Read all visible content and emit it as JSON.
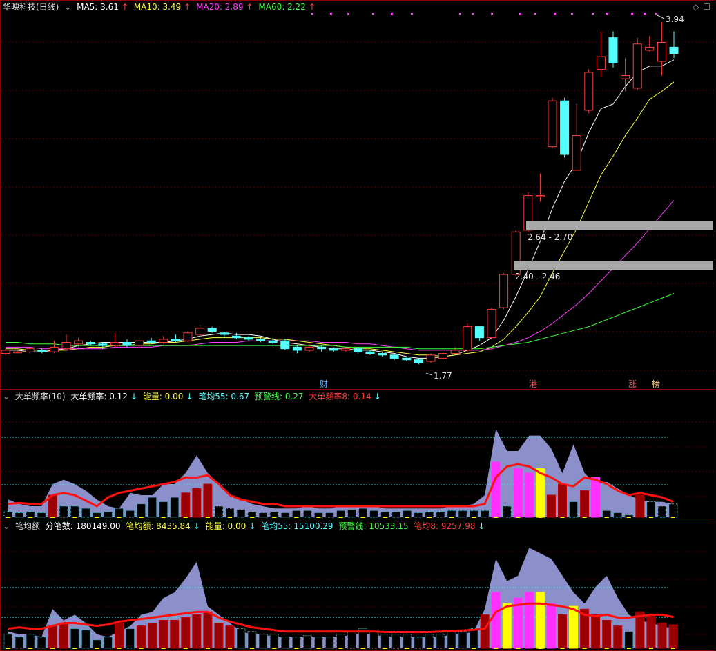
{
  "main": {
    "title": "华映科技(日线)",
    "ma5_label": "MA5: 3.61",
    "ma10_label": "MA10: 3.49",
    "ma20_label": "MA20: 2.89",
    "ma60_label": "MA60: 2.22",
    "high_label": "3.94",
    "low_label": "1.77",
    "zone1_label": "2.64 - 2.70",
    "zone2_label": "2.40 - 2.46",
    "markers": [
      "财",
      "港",
      "涨",
      "榜"
    ]
  },
  "panel1": {
    "title": "大单频率(10)",
    "v1": "大单频率: 0.12",
    "v2": "能量: 0.00",
    "v3": "笔均55: 0.67",
    "v4": "预警线: 0.27",
    "v5": "大单频率8: 0.14"
  },
  "panel2": {
    "title": "笔均额",
    "v1": "分笔数: 180149.00",
    "v2": "笔均额: 8435.84",
    "v3": "能量: 0.00",
    "v4": "笔均55: 15100.29",
    "v5": "预警线: 10533.15",
    "v6": "笔均8: 9257.98"
  },
  "colors": {
    "up": "#ff3c3c",
    "down": "#54ffff",
    "ma5": "#ffffff",
    "ma10": "#ffff40",
    "ma20": "#ff40ff",
    "ma60": "#40ff40",
    "area": "#9a9ee0"
  },
  "chart_data": [
    {
      "type": "candlestick",
      "title": "华映科技(日线)",
      "ylim": [
        1.72,
        4.0
      ],
      "series": [
        {
          "name": "K",
          "values": [
            [
              1.84,
              1.86,
              1.87,
              1.83
            ],
            [
              1.85,
              1.85,
              1.86,
              1.84
            ],
            [
              1.85,
              1.87,
              1.88,
              1.84
            ],
            [
              1.86,
              1.85,
              1.87,
              1.84
            ],
            [
              1.85,
              1.88,
              1.92,
              1.84
            ],
            [
              1.87,
              1.91,
              1.96,
              1.86
            ],
            [
              1.9,
              1.92,
              1.94,
              1.88
            ],
            [
              1.91,
              1.9,
              1.92,
              1.89
            ],
            [
              1.9,
              1.89,
              1.91,
              1.87
            ],
            [
              1.89,
              1.91,
              1.97,
              1.88
            ],
            [
              1.91,
              1.89,
              1.93,
              1.88
            ],
            [
              1.89,
              1.92,
              1.94,
              1.88
            ],
            [
              1.92,
              1.91,
              1.94,
              1.9
            ],
            [
              1.91,
              1.93,
              1.95,
              1.9
            ],
            [
              1.93,
              1.92,
              1.96,
              1.91
            ],
            [
              1.92,
              1.97,
              1.98,
              1.91
            ],
            [
              1.96,
              2.0,
              2.02,
              1.95
            ],
            [
              2.0,
              1.98,
              2.01,
              1.97
            ],
            [
              1.97,
              1.96,
              1.98,
              1.94
            ],
            [
              1.95,
              1.94,
              1.97,
              1.93
            ],
            [
              1.94,
              1.93,
              1.95,
              1.92
            ],
            [
              1.93,
              1.92,
              1.94,
              1.91
            ],
            [
              1.92,
              1.91,
              1.94,
              1.9
            ],
            [
              1.92,
              1.87,
              1.93,
              1.86
            ],
            [
              1.88,
              1.86,
              1.89,
              1.84
            ],
            [
              1.86,
              1.88,
              1.9,
              1.85
            ],
            [
              1.88,
              1.87,
              1.89,
              1.85
            ],
            [
              1.87,
              1.86,
              1.88,
              1.85
            ],
            [
              1.86,
              1.87,
              1.88,
              1.85
            ],
            [
              1.87,
              1.85,
              1.88,
              1.84
            ],
            [
              1.85,
              1.84,
              1.86,
              1.83
            ],
            [
              1.84,
              1.83,
              1.85,
              1.82
            ],
            [
              1.83,
              1.81,
              1.84,
              1.8
            ],
            [
              1.81,
              1.8,
              1.82,
              1.79
            ],
            [
              1.8,
              1.78,
              1.81,
              1.77
            ],
            [
              1.79,
              1.83,
              1.84,
              1.78
            ],
            [
              1.81,
              1.84,
              1.85,
              1.8
            ],
            [
              1.84,
              1.86,
              1.88,
              1.83
            ],
            [
              1.86,
              2.01,
              2.03,
              1.85
            ],
            [
              2.01,
              1.94,
              2.0,
              1.92
            ],
            [
              1.94,
              2.12,
              2.13,
              1.93
            ],
            [
              2.13,
              2.34,
              2.35,
              2.12
            ],
            [
              2.34,
              2.61,
              2.62,
              2.33
            ],
            [
              2.62,
              2.84,
              2.86,
              2.61
            ],
            [
              2.84,
              2.84,
              2.98,
              2.8
            ],
            [
              3.15,
              3.44,
              3.46,
              3.14
            ],
            [
              3.44,
              3.1,
              3.46,
              3.08
            ],
            [
              3.0,
              3.22,
              3.42,
              3.0
            ],
            [
              3.38,
              3.62,
              3.64,
              3.36
            ],
            [
              3.64,
              3.72,
              3.88,
              3.59
            ],
            [
              3.84,
              3.68,
              3.88,
              3.65
            ],
            [
              3.58,
              3.6,
              3.71,
              3.5
            ],
            [
              3.52,
              3.8,
              3.84,
              3.51
            ],
            [
              3.76,
              3.78,
              3.85,
              3.75
            ],
            [
              3.69,
              3.81,
              3.94,
              3.6
            ],
            [
              3.78,
              3.74,
              3.88,
              3.71
            ]
          ]
        },
        {
          "name": "MA5",
          "values": [
            1.86,
            1.86,
            1.85,
            1.85,
            1.86,
            1.87,
            1.89,
            1.9,
            1.91,
            1.91,
            1.91,
            1.91,
            1.91,
            1.91,
            1.92,
            1.93,
            1.95,
            1.96,
            1.97,
            1.96,
            1.96,
            1.95,
            1.93,
            1.91,
            1.9,
            1.89,
            1.88,
            1.87,
            1.87,
            1.86,
            1.86,
            1.85,
            1.84,
            1.82,
            1.81,
            1.81,
            1.82,
            1.83,
            1.86,
            1.89,
            1.94,
            2.05,
            2.2,
            2.37,
            2.55,
            2.76,
            2.93,
            3.05,
            3.24,
            3.39,
            3.42,
            3.53,
            3.62,
            3.66,
            3.66,
            3.7
          ]
        },
        {
          "name": "MA10",
          "values": [
            1.87,
            1.87,
            1.86,
            1.86,
            1.86,
            1.86,
            1.87,
            1.88,
            1.88,
            1.89,
            1.89,
            1.9,
            1.9,
            1.91,
            1.91,
            1.92,
            1.93,
            1.94,
            1.94,
            1.94,
            1.94,
            1.94,
            1.93,
            1.93,
            1.92,
            1.91,
            1.9,
            1.89,
            1.88,
            1.87,
            1.87,
            1.86,
            1.85,
            1.84,
            1.83,
            1.83,
            1.82,
            1.83,
            1.84,
            1.85,
            1.88,
            1.93,
            2.01,
            2.1,
            2.2,
            2.35,
            2.49,
            2.63,
            2.8,
            2.97,
            3.09,
            3.22,
            3.33,
            3.45,
            3.5,
            3.56
          ]
        },
        {
          "name": "MA20",
          "values": [
            1.88,
            1.88,
            1.88,
            1.87,
            1.87,
            1.87,
            1.87,
            1.87,
            1.87,
            1.88,
            1.88,
            1.88,
            1.88,
            1.89,
            1.89,
            1.89,
            1.9,
            1.91,
            1.91,
            1.91,
            1.92,
            1.92,
            1.92,
            1.92,
            1.92,
            1.92,
            1.91,
            1.91,
            1.91,
            1.9,
            1.9,
            1.89,
            1.88,
            1.87,
            1.86,
            1.86,
            1.86,
            1.86,
            1.86,
            1.86,
            1.87,
            1.89,
            1.91,
            1.94,
            1.98,
            2.03,
            2.09,
            2.15,
            2.22,
            2.3,
            2.38,
            2.46,
            2.54,
            2.63,
            2.72,
            2.81
          ]
        },
        {
          "name": "MA60",
          "values": [
            1.91,
            1.91,
            1.9,
            1.9,
            1.9,
            1.89,
            1.89,
            1.89,
            1.89,
            1.89,
            1.89,
            1.89,
            1.89,
            1.89,
            1.89,
            1.89,
            1.89,
            1.89,
            1.89,
            1.89,
            1.89,
            1.89,
            1.89,
            1.89,
            1.89,
            1.89,
            1.89,
            1.89,
            1.88,
            1.88,
            1.88,
            1.88,
            1.88,
            1.88,
            1.87,
            1.87,
            1.87,
            1.87,
            1.87,
            1.87,
            1.88,
            1.89,
            1.9,
            1.91,
            1.93,
            1.95,
            1.97,
            1.99,
            2.01,
            2.04,
            2.07,
            2.1,
            2.13,
            2.16,
            2.19,
            2.22
          ]
        }
      ]
    },
    {
      "type": "bar",
      "title": "大单频率(10)",
      "ylim": [
        0,
        1.0
      ],
      "series": [
        {
          "name": "大单频率",
          "values": [
            0.05,
            0.04,
            0.05,
            0.04,
            0.2,
            0.1,
            0.1,
            0.08,
            0.04,
            0.05,
            0.08,
            0.06,
            0.12,
            0.18,
            0.14,
            0.18,
            0.22,
            0.26,
            0.3,
            0.1,
            0.08,
            0.07,
            0.05,
            0.04,
            0.05,
            0.04,
            0.06,
            0.06,
            0.04,
            0.04,
            0.06,
            0.07,
            0.08,
            0.06,
            0.05,
            0.05,
            0.06,
            0.04,
            0.05,
            0.05,
            0.06,
            0.06,
            0.06,
            0.06,
            0.5,
            0.1,
            0.44,
            0.4,
            0.44,
            0.2,
            0.3,
            0.14,
            0.24,
            0.36,
            0.06,
            0.04,
            0.02,
            0.2,
            0.14,
            0.1,
            0.12
          ]
        },
        {
          "name": "能量",
          "values": [
            0.16,
            0.12,
            0.1,
            0.1,
            0.3,
            0.34,
            0.3,
            0.24,
            0.16,
            0.1,
            0.08,
            0.22,
            0.2,
            0.2,
            0.3,
            0.3,
            0.4,
            0.56,
            0.4,
            0.3,
            0.2,
            0.16,
            0.12,
            0.1,
            0.08,
            0.08,
            0.08,
            0.1,
            0.08,
            0.08,
            0.1,
            0.1,
            0.1,
            0.1,
            0.08,
            0.08,
            0.08,
            0.08,
            0.08,
            0.08,
            0.1,
            0.1,
            0.12,
            0.2,
            0.8,
            0.6,
            0.6,
            0.74,
            0.74,
            0.62,
            0.4,
            0.66,
            0.4,
            0.3,
            0.32,
            0.26,
            0.2,
            0.16,
            0.14,
            0.14,
            0.12
          ]
        },
        {
          "name": "大单频率8",
          "values": [
            0.12,
            0.13,
            0.12,
            0.12,
            0.2,
            0.22,
            0.2,
            0.15,
            0.1,
            0.18,
            0.22,
            0.24,
            0.26,
            0.28,
            0.3,
            0.32,
            0.36,
            0.36,
            0.38,
            0.3,
            0.2,
            0.16,
            0.14,
            0.12,
            0.12,
            0.1,
            0.1,
            0.1,
            0.1,
            0.1,
            0.1,
            0.1,
            0.1,
            0.1,
            0.1,
            0.1,
            0.1,
            0.1,
            0.1,
            0.1,
            0.1,
            0.1,
            0.1,
            0.12,
            0.36,
            0.46,
            0.48,
            0.46,
            0.4,
            0.36,
            0.3,
            0.28,
            0.36,
            0.34,
            0.3,
            0.24,
            0.2,
            0.22,
            0.2,
            0.18,
            0.14
          ]
        }
      ]
    },
    {
      "type": "bar",
      "title": "笔均额",
      "ylim": [
        0,
        40000
      ],
      "series": [
        {
          "name": "笔均额",
          "values": [
            5000,
            4000,
            5000,
            4000,
            8000,
            8500,
            7000,
            6500,
            3000,
            4000,
            9000,
            7000,
            8000,
            9000,
            10000,
            10000,
            11000,
            12000,
            13000,
            9000,
            8000,
            7000,
            6000,
            5000,
            5000,
            4000,
            4000,
            4500,
            4000,
            4000,
            5000,
            6000,
            7000,
            6000,
            5000,
            5000,
            5000,
            4000,
            5000,
            5000,
            6000,
            6000,
            7000,
            12000,
            20000,
            16000,
            18000,
            20000,
            20000,
            16000,
            12000,
            15000,
            14000,
            12000,
            10000,
            8000,
            6000,
            13000,
            12000,
            9000,
            8400
          ]
        },
        {
          "name": "能量",
          "values": [
            6000,
            5000,
            5000,
            4000,
            14000,
            10000,
            12000,
            9000,
            5000,
            4000,
            6000,
            8000,
            12000,
            13000,
            18000,
            20000,
            25000,
            31000,
            15000,
            12000,
            9000,
            6000,
            5000,
            5000,
            4000,
            4000,
            4000,
            4000,
            4000,
            4000,
            4000,
            5000,
            5000,
            5000,
            4000,
            4000,
            4000,
            4000,
            4000,
            4000,
            5000,
            5000,
            6000,
            14000,
            32000,
            24000,
            26000,
            36000,
            34000,
            32000,
            26000,
            20000,
            16000,
            22000,
            26000,
            18000,
            12000,
            10000,
            9000,
            8000,
            7000
          ]
        },
        {
          "name": "笔均8",
          "values": [
            7000,
            7500,
            7000,
            7000,
            8000,
            9000,
            9000,
            8500,
            8000,
            8500,
            9500,
            10000,
            10500,
            11000,
            11500,
            12000,
            12500,
            13000,
            13000,
            11000,
            9500,
            8500,
            7500,
            7000,
            6500,
            6000,
            6000,
            6000,
            6000,
            6000,
            6000,
            6000,
            6000,
            6000,
            5800,
            5800,
            5800,
            5800,
            5800,
            6000,
            6200,
            6400,
            6600,
            7000,
            13000,
            15000,
            15500,
            16000,
            16000,
            15500,
            15000,
            14000,
            12000,
            11500,
            12000,
            11000,
            11000,
            11500,
            12000,
            12000,
            11200
          ]
        }
      ]
    }
  ]
}
